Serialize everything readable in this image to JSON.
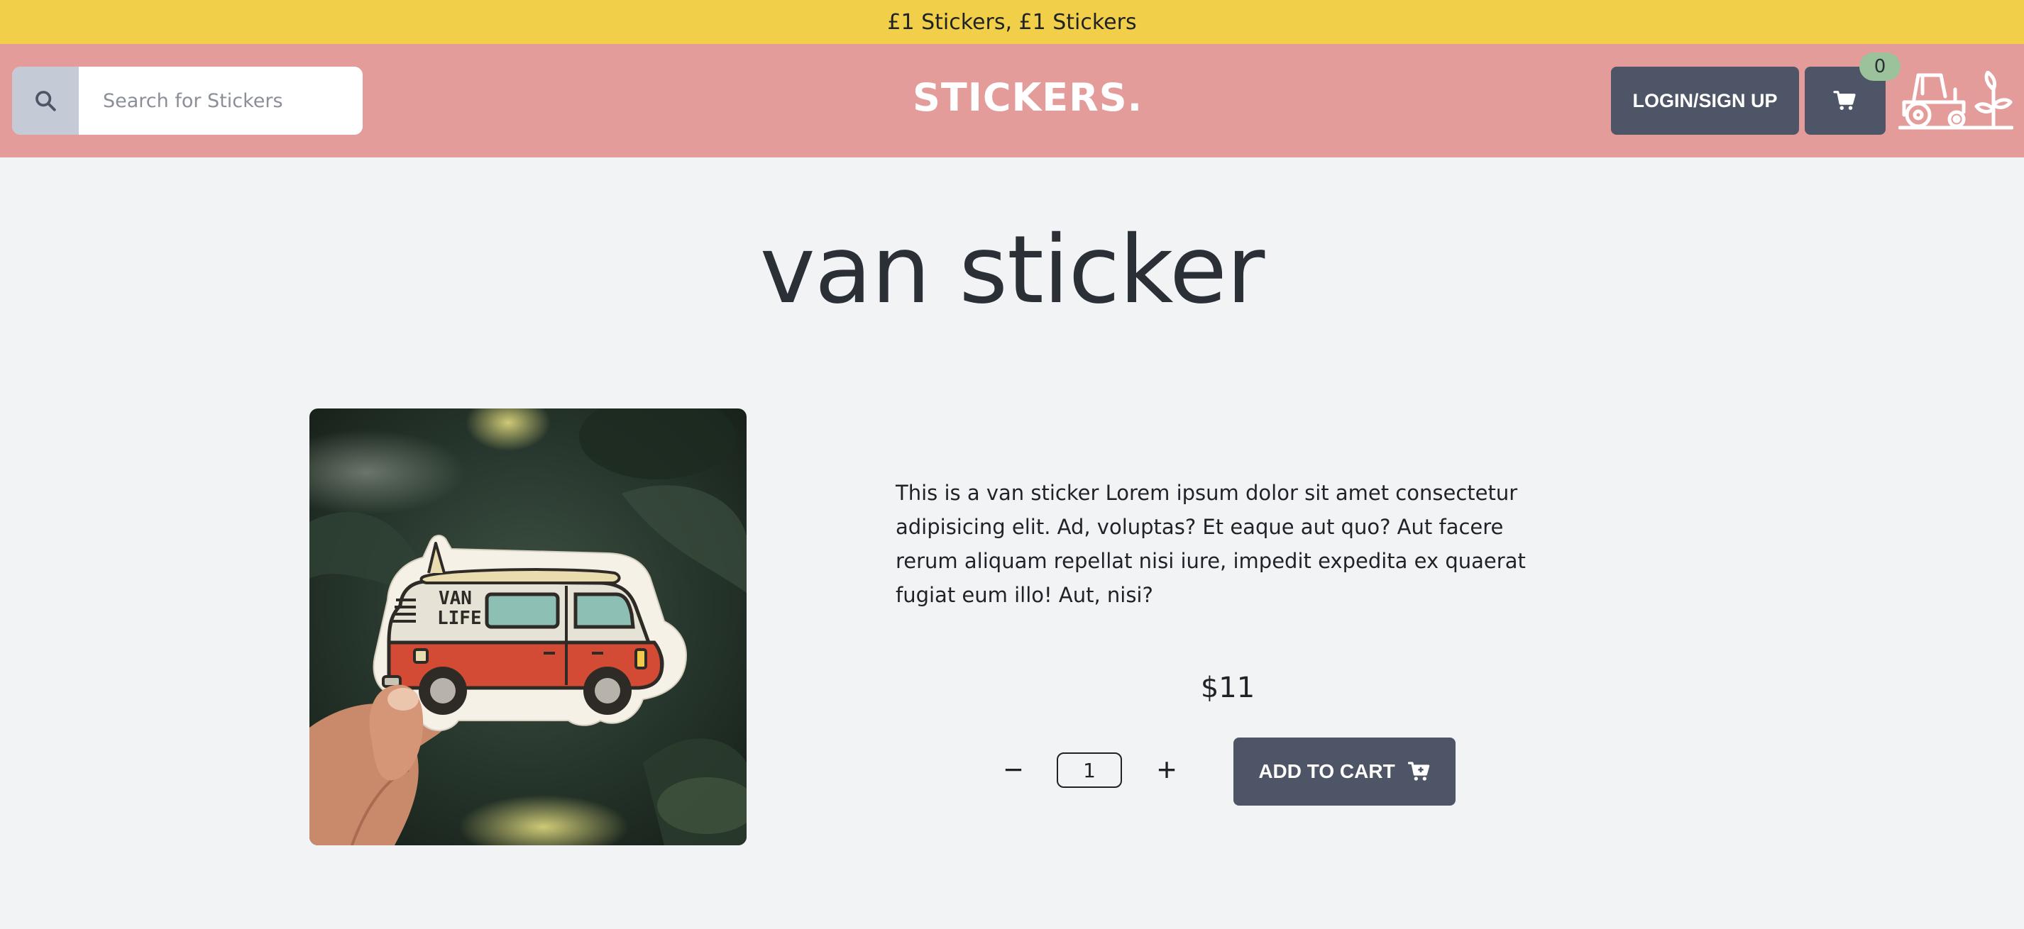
{
  "announcement": "£1 Stickers, £1 Stickers",
  "header": {
    "search_placeholder": "Search for Stickers",
    "brand": "STICKERS.",
    "login_label": "LOGIN/SIGN UP",
    "cart_count": "0"
  },
  "product": {
    "title": "van sticker",
    "description": "This is a van sticker Lorem ipsum dolor sit amet consectetur adipisicing elit. Ad, voluptas? Et eaque aut quo? Aut facere rerum aliquam repellat nisi iure, impedit expedita ex quaerat fugiat eum illo! Aut, nisi?",
    "price": "$11",
    "quantity": "1",
    "decrement_label": "−",
    "increment_label": "+",
    "add_to_cart_label": "ADD TO CART",
    "sticker_text_line1": "VAN",
    "sticker_text_line2": "LIFE"
  },
  "colors": {
    "announcement_bg": "#f2cf49",
    "header_bg": "#e39c9a",
    "button_bg": "#4d5566",
    "badge_bg": "#9cc29c",
    "page_bg": "#f2f3f5"
  },
  "icons": {
    "search": "search-icon",
    "cart": "cart-icon",
    "logo": "tractor-plant-icon",
    "add_to_cart": "cart-plus-icon"
  }
}
